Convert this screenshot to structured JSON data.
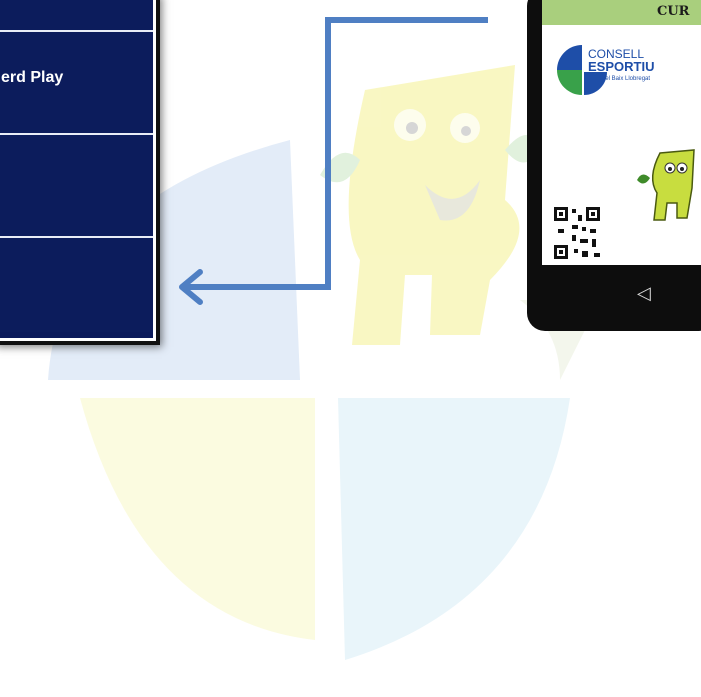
{
  "menu": {
    "items": [
      {
        "label": ""
      },
      {
        "label": "erd Play"
      },
      {
        "label": ""
      },
      {
        "label": ""
      }
    ]
  },
  "phone": {
    "header_text": "CUR",
    "logo": {
      "line1": "CONSELL",
      "line2": "ESPORTIU",
      "line3": "del Baix Llobregat"
    },
    "nav_back_symbol": "◁"
  },
  "colors": {
    "menu_bg": "#0c1c5c",
    "arrow": "#4f7fc3",
    "phone_header": "#a9cf7d",
    "logo_blue": "#1e4ea8",
    "logo_green": "#39a14a",
    "mascot_yellow": "#f6f59a"
  }
}
